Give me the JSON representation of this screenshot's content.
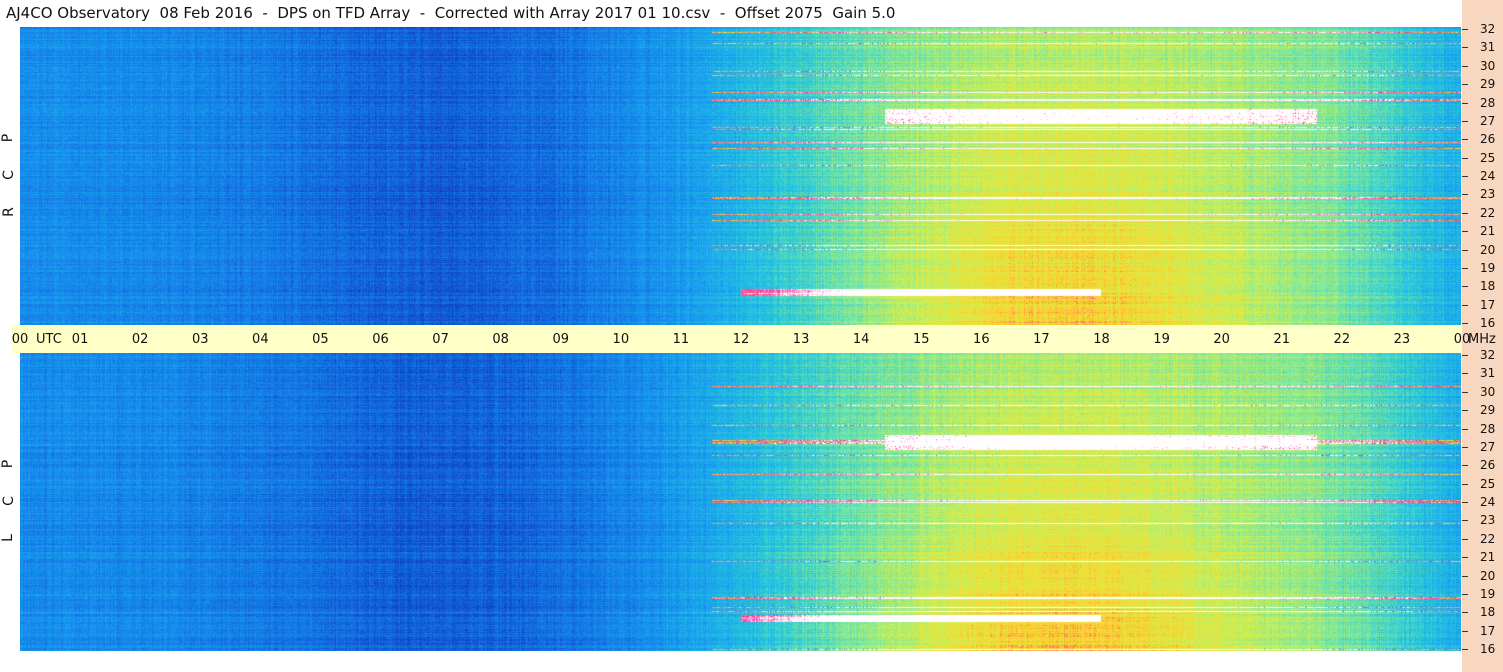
{
  "title": "AJ4CO Observatory  08 Feb 2016  -  DPS on TFD Array  -  Corrected with Array 2017 01 10.csv  -  Offset 2075  Gain 5.0",
  "panels": [
    {
      "id": "top",
      "polarization_label": [
        "R",
        "C",
        "P"
      ]
    },
    {
      "id": "bottom",
      "polarization_label": [
        "L",
        "C",
        "P"
      ]
    }
  ],
  "time_axis": {
    "ticks": [
      "00",
      "01",
      "02",
      "03",
      "04",
      "05",
      "06",
      "07",
      "08",
      "09",
      "10",
      "11",
      "12",
      "13",
      "14",
      "15",
      "16",
      "17",
      "18",
      "19",
      "20",
      "21",
      "22",
      "23",
      "00"
    ],
    "unit_label": "UTC",
    "freq_unit_label": "MHz"
  },
  "freq_axis": {
    "ticks": [
      "32",
      "31",
      "30",
      "29",
      "28",
      "27",
      "26",
      "25",
      "24",
      "23",
      "22",
      "21",
      "20",
      "19",
      "18",
      "17",
      "16"
    ]
  },
  "colors": {
    "background": "#ffffff",
    "axis_strip": "#f8d7c0",
    "time_axis_bg": "#ffffc8",
    "colormap": [
      "#0a1e8c",
      "#0f46c8",
      "#1478e6",
      "#19a0f0",
      "#28c8dc",
      "#78e6a0",
      "#d2f050",
      "#ffd228",
      "#ff2896",
      "#ffffff"
    ]
  }
}
